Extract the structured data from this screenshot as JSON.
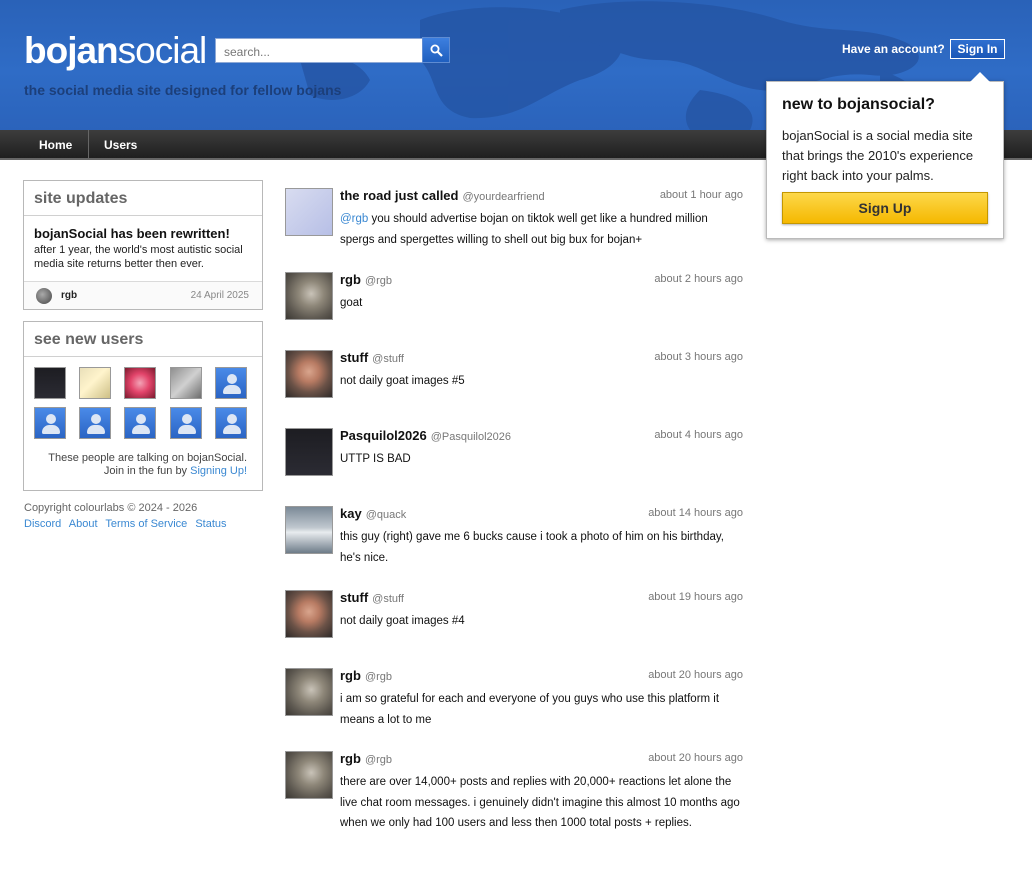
{
  "brand": {
    "logo_bold": "bojan",
    "logo_light": "social",
    "tagline": "the social media site designed for fellow bojans"
  },
  "search": {
    "placeholder": "search..."
  },
  "account": {
    "prompt": "Have an account?",
    "signin_label": "Sign In"
  },
  "nav": {
    "items": [
      {
        "label": "Home"
      },
      {
        "label": "Users"
      }
    ]
  },
  "popup": {
    "title": "new to bojansocial?",
    "body": "bojanSocial is a social media site that brings the 2010's experience right back into your palms.",
    "signup_label": "Sign Up"
  },
  "site_updates": {
    "title": "site updates",
    "headline": "bojanSocial has been rewritten!",
    "body": "after 1 year, the world's most autistic social media site returns better then ever.",
    "author": "rgb",
    "date": "24 April 2025"
  },
  "new_users": {
    "title": "see new users",
    "note_line1": "These people are talking on bojanSocial.",
    "note_line2_prefix": "Join in the fun by",
    "note_link": "Signing Up!"
  },
  "footer": {
    "copyright": "Copyright colourlabs © 2024 - 2026",
    "links": [
      "Discord",
      "About",
      "Terms of Service",
      "Status"
    ]
  },
  "posts": [
    {
      "name": "the road just called",
      "handle": "@yourdearfriend",
      "time": "about 1 hour ago",
      "mention": "@rgb",
      "text": " you should advertise bojan on tiktok well get like a hundred million spergs and spergettes willing to shell out big bux for bojan+"
    },
    {
      "name": "rgb",
      "handle": "@rgb",
      "time": "about 2 hours ago",
      "text": "goat"
    },
    {
      "name": "stuff",
      "handle": "@stuff",
      "time": "about 3 hours ago",
      "text": "not daily goat images #5"
    },
    {
      "name": "Pasquilol2026",
      "handle": "@Pasquilol2026",
      "time": "about 4 hours ago",
      "text": "UTTP IS BAD"
    },
    {
      "name": "kay",
      "handle": "@quack",
      "time": "about 14 hours ago",
      "text": "this guy (right) gave me 6 bucks cause i took a photo of him on his birthday, he's nice."
    },
    {
      "name": "stuff",
      "handle": "@stuff",
      "time": "about 19 hours ago",
      "text": "not daily goat images #4"
    },
    {
      "name": "rgb",
      "handle": "@rgb",
      "time": "about 20 hours ago",
      "text": "i am so grateful for each and everyone of you guys who use this platform it means a lot to me"
    },
    {
      "name": "rgb",
      "handle": "@rgb",
      "time": "about 20 hours ago",
      "text": "there are over 14,000+ posts and replies with 20,000+ reactions let alone the live chat room messages. i genuinely didn't imagine this almost 10 months ago when we only had 100 users and less then 1000 total posts + replies."
    }
  ]
}
